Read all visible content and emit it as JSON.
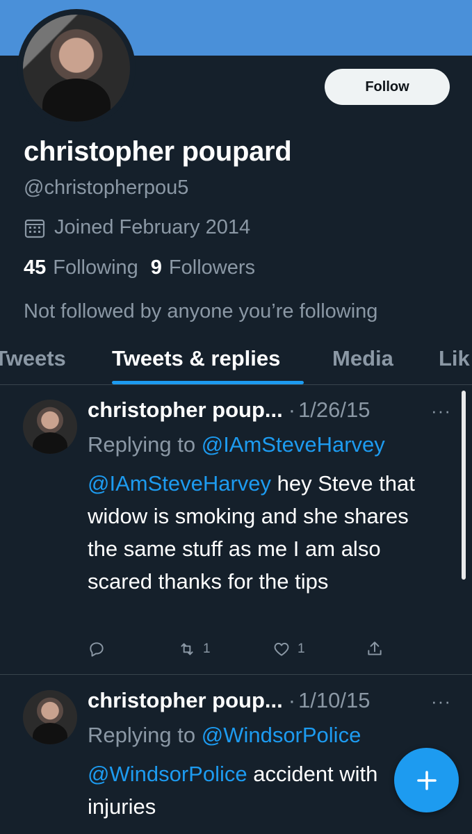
{
  "profile": {
    "display_name": "christopher poupard",
    "handle": "@christopherpou5",
    "joined": "Joined February 2014",
    "following_count": "45",
    "following_label": "Following",
    "followers_count": "9",
    "followers_label": "Followers",
    "not_followed": "Not followed by anyone you’re following",
    "follow_label": "Follow"
  },
  "tabs": [
    {
      "label": "Tweets"
    },
    {
      "label": "Tweets & replies"
    },
    {
      "label": "Media"
    },
    {
      "label": "Lik"
    }
  ],
  "tweets": [
    {
      "name": "christopher poup...",
      "date": "1/26/15",
      "replying_prefix": "Replying to ",
      "replying_to": "@IAmSteveHarvey",
      "mention": "@IAmSteveHarvey",
      "text": " hey Steve that widow is smoking and she shares the same stuff as me I am also scared thanks for the tips",
      "retweets": "1",
      "likes": "1"
    },
    {
      "name": "christopher poup...",
      "date": "1/10/15",
      "replying_prefix": "Replying to ",
      "replying_to": "@WindsorPolice",
      "mention": "@WindsorPolice",
      "text": " accident with injuries"
    }
  ],
  "icons": {
    "calendar": "calendar-icon",
    "reply": "reply-icon",
    "retweet": "retweet-icon",
    "like": "heart-icon",
    "share": "share-icon",
    "compose": "plus-icon",
    "more": "more-icon"
  },
  "colors": {
    "background": "#15202b",
    "banner": "#4a90d9",
    "accent": "#1d9bf0",
    "muted": "#8b98a5"
  }
}
